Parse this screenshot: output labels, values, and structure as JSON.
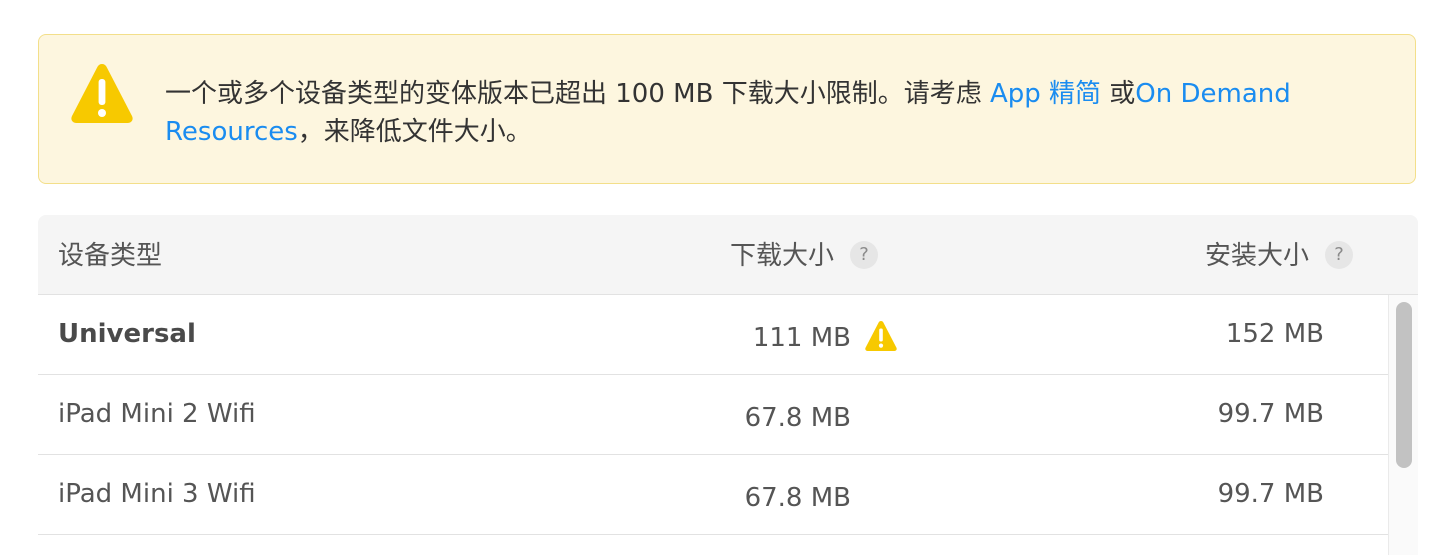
{
  "warning": {
    "icon": "warning-triangle-icon",
    "text_before": "一个或多个设备类型的变体版本已超出 100 MB 下载大小限制。请考虑 ",
    "link1": "App 精简",
    "text_middle": " 或",
    "link2": "On Demand Resources",
    "text_after": "，来降低文件大小。",
    "colors": {
      "background": "#fdf6df",
      "border": "#f3df8a",
      "icon": "#f7c900",
      "link": "#1a8cf0"
    }
  },
  "table": {
    "headers": {
      "device": "设备类型",
      "download": "下载大小",
      "install": "安装大小",
      "help_glyph": "?"
    },
    "rows": [
      {
        "device": "Universal",
        "download": "111 MB",
        "install": "152 MB",
        "warning": true
      },
      {
        "device": "iPad Mini 2 Wifi",
        "download": "67.8 MB",
        "install": "99.7 MB",
        "warning": false
      },
      {
        "device": "iPad Mini 3 Wifi",
        "download": "67.8 MB",
        "install": "99.7 MB",
        "warning": false
      }
    ]
  }
}
